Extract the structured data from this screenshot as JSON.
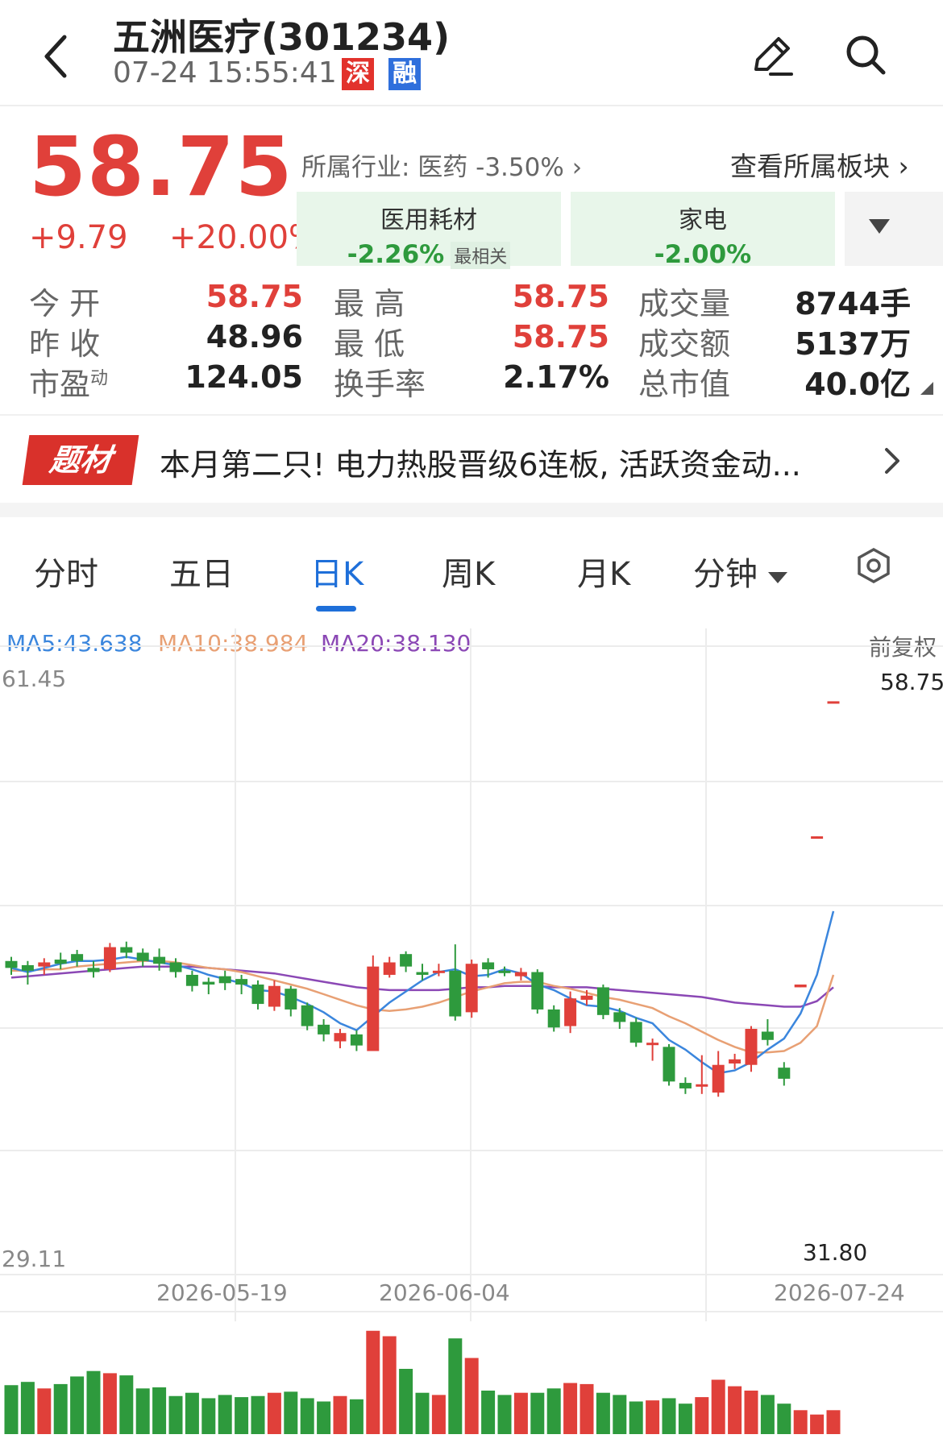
{
  "header": {
    "title": "五洲医疗(301234)",
    "datetime": "07-24 15:55:41",
    "tags": [
      "深",
      "融"
    ],
    "tag_colors": [
      "#e2322c",
      "#2f6fdc"
    ]
  },
  "quote": {
    "price": "58.75",
    "change": "+9.79",
    "change_pct": "+20.00%",
    "industry": "所属行业: 医药 -3.50%",
    "view_sector": "查看所属板块",
    "sectors": [
      {
        "name": "医用耗材",
        "value": "-2.26%",
        "badge": "最相关"
      },
      {
        "name": "家电",
        "value": "-2.00%"
      }
    ],
    "stats": {
      "open_label": "今  开",
      "open": "58.75",
      "prev_close_label": "昨  收",
      "prev_close": "48.96",
      "pe_label": "市盈",
      "pe_sup": "动",
      "pe": "124.05",
      "high_label": "最  高",
      "high": "58.75",
      "low_label": "最  低",
      "low": "58.75",
      "turnover_label": "换手率",
      "turnover": "2.17%",
      "volume_label": "成交量",
      "volume": "8744手",
      "amount_label": "成交额",
      "amount": "5137万",
      "mktcap_label": "总市值",
      "mktcap": "40.0亿"
    },
    "colors": {
      "up": "#e0403a",
      "down": "#2e9a3d",
      "neutral": "#222222"
    }
  },
  "news": {
    "badge": "题材",
    "text": "本月第二只! 电力热股晋级6连板, 活跃资金动..."
  },
  "tabs": [
    "分时",
    "五日",
    "日K",
    "周K",
    "月K",
    "分钟"
  ],
  "active_tab": "日K",
  "chart": {
    "ma5": "MA5:43.638",
    "ma10": "MA10:38.984",
    "ma20": "MA20:38.130",
    "ma_colors": {
      "ma5": "#3b86dd",
      "ma10": "#e8a074",
      "ma20": "#8b48b5"
    },
    "adjust": "前复权",
    "y_max": "61.45",
    "y_min": "29.11",
    "last_label": "58.75",
    "low_label": "31.80",
    "dates": [
      "2026-05-19",
      "2026-06-04",
      "2026-07-24"
    ]
  },
  "chart_data": {
    "type": "candlestick",
    "ylim": [
      29.11,
      61.45
    ],
    "candles": [
      {
        "o": 40.0,
        "c": 39.5,
        "h": 40.3,
        "l": 39.0
      },
      {
        "o": 39.7,
        "c": 39.3,
        "h": 40.0,
        "l": 38.3
      },
      {
        "o": 39.6,
        "c": 39.9,
        "h": 40.2,
        "l": 39.0
      },
      {
        "o": 40.1,
        "c": 39.8,
        "h": 40.6,
        "l": 39.4
      },
      {
        "o": 40.5,
        "c": 40.0,
        "h": 40.8,
        "l": 39.6
      },
      {
        "o": 39.5,
        "c": 39.2,
        "h": 40.0,
        "l": 38.8
      },
      {
        "o": 39.4,
        "c": 41.0,
        "h": 41.3,
        "l": 39.2
      },
      {
        "o": 41.0,
        "c": 40.6,
        "h": 41.4,
        "l": 40.2
      },
      {
        "o": 40.6,
        "c": 40.0,
        "h": 40.9,
        "l": 39.6
      },
      {
        "o": 40.3,
        "c": 39.8,
        "h": 40.9,
        "l": 39.3
      },
      {
        "o": 39.9,
        "c": 39.2,
        "h": 40.2,
        "l": 38.8
      },
      {
        "o": 39.0,
        "c": 38.2,
        "h": 39.3,
        "l": 37.8
      },
      {
        "o": 38.5,
        "c": 38.3,
        "h": 38.8,
        "l": 37.6
      },
      {
        "o": 38.9,
        "c": 38.4,
        "h": 39.3,
        "l": 37.9
      },
      {
        "o": 38.7,
        "c": 38.3,
        "h": 39.0,
        "l": 37.6
      },
      {
        "o": 38.3,
        "c": 36.9,
        "h": 38.6,
        "l": 36.5
      },
      {
        "o": 36.7,
        "c": 38.2,
        "h": 38.6,
        "l": 36.4
      },
      {
        "o": 38.0,
        "c": 36.5,
        "h": 38.2,
        "l": 36.0
      },
      {
        "o": 36.8,
        "c": 35.3,
        "h": 37.0,
        "l": 35.0
      },
      {
        "o": 35.4,
        "c": 34.7,
        "h": 35.8,
        "l": 34.2
      },
      {
        "o": 34.2,
        "c": 34.8,
        "h": 35.1,
        "l": 33.7
      },
      {
        "o": 34.7,
        "c": 33.9,
        "h": 35.0,
        "l": 33.5
      },
      {
        "o": 33.5,
        "c": 39.6,
        "h": 40.4,
        "l": 33.5
      },
      {
        "o": 39.0,
        "c": 39.9,
        "h": 40.3,
        "l": 38.8
      },
      {
        "o": 40.5,
        "c": 39.6,
        "h": 40.7,
        "l": 39.2
      },
      {
        "o": 39.2,
        "c": 39.0,
        "h": 39.8,
        "l": 38.6
      },
      {
        "o": 39.3,
        "c": 39.3,
        "h": 39.8,
        "l": 38.9
      },
      {
        "o": 39.3,
        "c": 36.0,
        "h": 41.2,
        "l": 35.7
      },
      {
        "o": 36.3,
        "c": 39.8,
        "h": 40.1,
        "l": 35.9
      },
      {
        "o": 39.9,
        "c": 39.4,
        "h": 40.2,
        "l": 38.8
      },
      {
        "o": 39.3,
        "c": 39.2,
        "h": 39.6,
        "l": 38.9
      },
      {
        "o": 38.9,
        "c": 39.2,
        "h": 39.5,
        "l": 38.6
      },
      {
        "o": 39.2,
        "c": 36.5,
        "h": 39.4,
        "l": 36.2
      },
      {
        "o": 36.5,
        "c": 35.2,
        "h": 36.8,
        "l": 34.9
      },
      {
        "o": 35.3,
        "c": 37.3,
        "h": 37.8,
        "l": 34.8
      },
      {
        "o": 37.2,
        "c": 37.5,
        "h": 37.9,
        "l": 36.8
      },
      {
        "o": 38.1,
        "c": 36.1,
        "h": 38.3,
        "l": 35.8
      },
      {
        "o": 36.3,
        "c": 35.6,
        "h": 36.6,
        "l": 35.1
      },
      {
        "o": 35.6,
        "c": 34.1,
        "h": 35.9,
        "l": 33.8
      },
      {
        "o": 34.0,
        "c": 34.1,
        "h": 34.4,
        "l": 32.8
      },
      {
        "o": 33.8,
        "c": 31.3,
        "h": 34.0,
        "l": 31.0
      },
      {
        "o": 31.2,
        "c": 30.8,
        "h": 31.6,
        "l": 30.4
      },
      {
        "o": 31.0,
        "c": 31.1,
        "h": 33.2,
        "l": 30.4
      },
      {
        "o": 30.5,
        "c": 32.5,
        "h": 33.5,
        "l": 30.2
      },
      {
        "o": 32.6,
        "c": 32.9,
        "h": 33.3,
        "l": 32.2
      },
      {
        "o": 32.5,
        "c": 35.1,
        "h": 35.3,
        "l": 32.0
      },
      {
        "o": 34.9,
        "c": 34.3,
        "h": 35.8,
        "l": 33.9
      },
      {
        "o": 32.3,
        "c": 31.5,
        "h": 32.7,
        "l": 31.0
      },
      {
        "o": 38.1,
        "c": 38.3,
        "h": 38.3,
        "l": 38.1
      },
      {
        "o": 48.9,
        "c": 49.0,
        "h": 49.0,
        "l": 48.9
      },
      {
        "o": 58.75,
        "c": 58.75,
        "h": 58.75,
        "l": 58.75
      }
    ],
    "ma5": [
      39.5,
      39.2,
      39.5,
      39.8,
      40.0,
      40.0,
      40.1,
      40.3,
      40.1,
      39.9,
      39.7,
      39.4,
      39.0,
      38.7,
      38.4,
      37.9,
      37.8,
      37.4,
      36.9,
      36.3,
      35.5,
      35.0,
      36.0,
      37.0,
      37.8,
      38.6,
      39.2,
      39.4,
      38.9,
      39.0,
      39.4,
      39.1,
      38.3,
      37.9,
      37.3,
      36.8,
      36.7,
      36.4,
      35.9,
      35.5,
      34.3,
      33.6,
      32.7,
      31.9,
      32.1,
      32.7,
      33.6,
      34.4,
      36.2,
      39.0,
      43.6
    ],
    "ma10": [
      39.3,
      39.3,
      39.4,
      39.4,
      39.6,
      39.7,
      39.8,
      39.9,
      40.0,
      40.0,
      39.9,
      39.7,
      39.5,
      39.4,
      39.2,
      38.9,
      38.6,
      38.3,
      38.0,
      37.6,
      37.2,
      36.8,
      36.5,
      36.4,
      36.5,
      36.7,
      37.0,
      37.4,
      37.8,
      38.1,
      38.4,
      38.5,
      38.5,
      38.2,
      38.0,
      37.7,
      37.4,
      37.2,
      36.9,
      36.6,
      36.0,
      35.5,
      34.9,
      34.3,
      33.8,
      33.4,
      33.4,
      33.5,
      34.1,
      35.3,
      39.0
    ],
    "ma20": [
      38.8,
      38.9,
      39.0,
      39.1,
      39.2,
      39.3,
      39.4,
      39.5,
      39.6,
      39.6,
      39.6,
      39.6,
      39.5,
      39.4,
      39.3,
      39.2,
      39.1,
      38.9,
      38.7,
      38.5,
      38.3,
      38.1,
      38.0,
      37.9,
      37.9,
      37.9,
      37.9,
      38.0,
      38.1,
      38.1,
      38.2,
      38.2,
      38.2,
      38.1,
      38.1,
      38.1,
      38.0,
      37.9,
      37.8,
      37.7,
      37.6,
      37.5,
      37.4,
      37.2,
      37.0,
      36.9,
      36.8,
      36.7,
      36.7,
      37.1,
      38.1
    ],
    "volumes": [
      45,
      48,
      42,
      46,
      53,
      58,
      56,
      54,
      42,
      43,
      35,
      38,
      33,
      36,
      34,
      35,
      38,
      39,
      33,
      30,
      35,
      32,
      95,
      90,
      60,
      38,
      36,
      88,
      70,
      40,
      36,
      38,
      38,
      42,
      47,
      46,
      38,
      36,
      30,
      31,
      33,
      28,
      34,
      50,
      44,
      40,
      36,
      28,
      22,
      18,
      22
    ]
  }
}
